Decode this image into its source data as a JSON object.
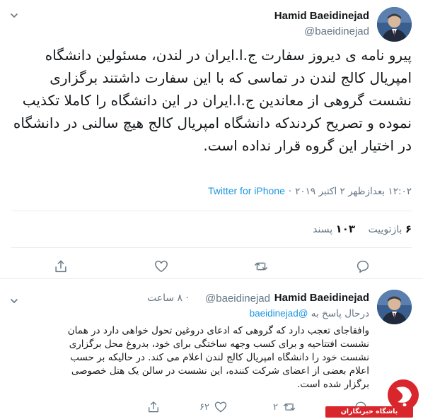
{
  "main_tweet": {
    "author_name": "Hamid Baeidinejad",
    "author_handle": "@baeidinejad",
    "text": "پیرو نامه ی دیروز سفارت ج.ا.ایران در لندن، مسئولین دانشگاه امپریال کالج لندن در تماسی که با این سفارت داشتند برگزاری نشست گروهی از معاندین ج.ا.ایران در این دانشگاه را کاملا تکذیب نموده و تصریح کردندکه دانشگاه امپریال کالج هیچ سالنی در دانشگاه در اختیار این گروه قرار نداده است.",
    "timestamp": "۱۲:۰۲ بعدازظهر ۲ اکتبر ۲۰۱۹",
    "separator": "·",
    "source": "Twitter for iPhone",
    "retweets_count": "۶",
    "retweets_label": "بازتوییت",
    "likes_count": "۱۰۳",
    "likes_label": "پسند"
  },
  "reply_tweet": {
    "author_name": "Hamid Baeidinejad",
    "author_handle": "@baeidinejad",
    "time_ago": "۸ ساعت",
    "separator": "·",
    "replying_prefix": "درحال پاسخ به",
    "replying_mention": "@baeidinejad",
    "text": "وافقاجای تعجب دارد که گروهی که ادعای دروغین تحول خواهی دارد در همان نشست افتتاحیه و برای کسب وجهه ساختگی برای خود، بدروغ محل برگزاری نشست خود را دانشگاه امپریال کالج لندن اعلام می کند. در حالیکه بر حسب اعلام بعضی از اعضای شرکت کننده، این نشست در سالن یک هتل خصوصی برگزار شده است.",
    "likes_count": "۶۲",
    "retweets_count": "۲"
  },
  "watermark": {
    "text": "باشگاه خبرنگاران"
  },
  "colors": {
    "link": "#1b95e0",
    "muted": "#657786",
    "text": "#14171a",
    "divider": "#e6ecf0",
    "watermark_red": "#d8262c"
  }
}
